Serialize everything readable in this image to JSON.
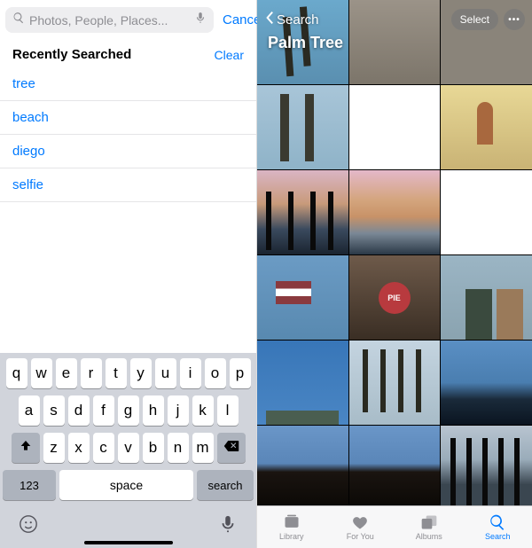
{
  "left": {
    "search_placeholder": "Photos, People, Places...",
    "cancel": "Cancel",
    "recent_header": "Recently Searched",
    "clear": "Clear",
    "recent": [
      "tree",
      "beach",
      "diego",
      "selfie"
    ],
    "keyboard": {
      "row1": [
        "q",
        "w",
        "e",
        "r",
        "t",
        "y",
        "u",
        "i",
        "o",
        "p"
      ],
      "row2": [
        "a",
        "s",
        "d",
        "f",
        "g",
        "h",
        "j",
        "k",
        "l"
      ],
      "row3": [
        "z",
        "x",
        "c",
        "v",
        "b",
        "n",
        "m"
      ],
      "numkey": "123",
      "space": "space",
      "action": "search"
    }
  },
  "right": {
    "back_label": "Search",
    "select": "Select",
    "title": "Palm Tree",
    "tabs": [
      {
        "label": "Library"
      },
      {
        "label": "For You"
      },
      {
        "label": "Albums"
      },
      {
        "label": "Search"
      }
    ],
    "active_tab": 3
  }
}
